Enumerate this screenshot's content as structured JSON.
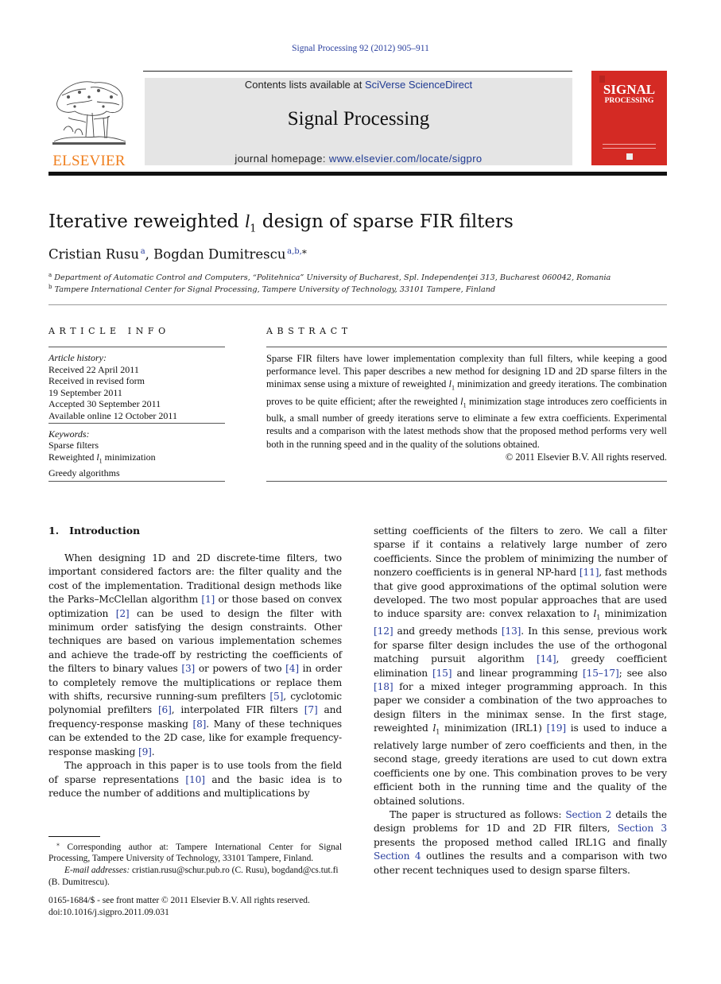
{
  "header": {
    "journal_ref": "Signal Processing 92 (2012) 905–911",
    "contents_prefix": "Contents lists available at ",
    "contents_link": "SciVerse ScienceDirect",
    "journal_title": "Signal Processing",
    "homepage_prefix": "journal homepage: ",
    "homepage_link": "www.elsevier.com/locate/sigpro",
    "publisher_logo_text": "ELSEVIER",
    "cover_title_line1": "SIGNAL",
    "cover_title_line2": "PROCESSING",
    "colors": {
      "elsevier_orange": "#f07f1e",
      "cover_red": "#d42a24",
      "link_blue": "#2a3f9e",
      "banner_gray": "#e5e5e5"
    }
  },
  "article": {
    "title_before": "Iterative reweighted ",
    "title_var": "l",
    "title_sub": "1",
    "title_after": " design of sparse FIR filters",
    "authors": [
      {
        "name": "Cristian Rusu",
        "marks": "a",
        "sep": ", "
      },
      {
        "name": "Bogdan Dumitrescu",
        "marks": "a,b,",
        "star": "⁎"
      }
    ],
    "affiliations": [
      {
        "mark": "a",
        "text": "Department of Automatic Control and Computers, “Politehnica” University of Bucharest, Spl. Independenţei 313, Bucharest 060042, Romania"
      },
      {
        "mark": "b",
        "text": "Tampere International Center for Signal Processing, Tampere University of Technology, 33101 Tampere, Finland"
      }
    ]
  },
  "article_info": {
    "heading": "ARTICLE INFO",
    "history_label": "Article history:",
    "history": [
      "Received 22 April 2011",
      "Received in revised form",
      "19 September 2011",
      "Accepted 30 September 2011",
      "Available online 12 October 2011"
    ],
    "keywords_label": "Keywords:",
    "keywords": [
      "Sparse filters",
      "Reweighted l1 minimization",
      "Greedy algorithms"
    ],
    "keyword2_before": "Reweighted ",
    "keyword2_var": "l",
    "keyword2_sub": "1",
    "keyword2_after": " minimization"
  },
  "abstract": {
    "heading": "ABSTRACT",
    "p1": "Sparse FIR filters have lower implementation complexity than full filters, while keeping a good performance level. This paper describes a new method for designing 1D and 2D sparse filters in the minimax sense using a mixture of reweighted ",
    "p2": " minimization and greedy iterations. The combination proves to be quite efficient; after the reweighted ",
    "p3": " minimization stage introduces zero coefficients in bulk, a small number of greedy iterations serve to eliminate a few extra coefficients. Experimental results and a comparison with the latest methods show that the proposed method performs very well both in the running speed and in the quality of the solutions obtained.",
    "l": "l",
    "one": "1",
    "copyright": "© 2011 Elsevier B.V. All rights reserved."
  },
  "intro": {
    "heading": "1.   Introduction",
    "left": {
      "s1": "When designing 1D and 2D discrete-time filters, two important considered factors are: the filter quality and the cost of the implementation. Traditional design methods like the Parks–McClellan algorithm ",
      "c1": "[1]",
      "s2": " or those based on convex optimization ",
      "c2": "[2]",
      "s3": " can be used to design the filter with minimum order satisfying the design constraints. Other techniques are based on various implementation schemes and achieve the trade-off by restricting the coefficients of the filters to binary values ",
      "c3": "[3]",
      "s4": " or powers of two ",
      "c4": "[4]",
      "s5": " in order to completely remove the multiplications or replace them with shifts, recursive running-sum prefilters ",
      "c5": "[5]",
      "s6": ", cyclotomic polynomial prefilters ",
      "c6": "[6]",
      "s7": ", interpolated FIR filters ",
      "c7": "[7]",
      "s8": " and frequency-response masking ",
      "c8": "[8]",
      "s9": ". Many of these techniques can be extended to the 2D case, like for example frequency-response masking ",
      "c9": "[9]",
      "s10": ".",
      "p2a": "The approach in this paper is to use tools from the field of sparse representations ",
      "c10": "[10]",
      "p2b": " and the basic idea is to reduce the number of additions and multiplications by"
    },
    "right": {
      "s1": "setting coefficients of the filters to zero. We call a filter sparse if it contains a relatively large number of zero coefficients. Since the problem of minimizing the number of nonzero coefficients is in general NP-hard ",
      "c11": "[11]",
      "s2": ", fast methods that give good approximations of the optimal solution were developed. The two most popular approaches that are used to induce sparsity are: convex relaxation to ",
      "s3": " minimization ",
      "c12": "[12]",
      "s4": " and greedy methods ",
      "c13": "[13]",
      "s5": ". In this sense, previous work for sparse filter design includes the use of the orthogonal matching pursuit algorithm ",
      "c14": "[14]",
      "s6": ", greedy coefficient elimination ",
      "c15": "[15]",
      "s7": " and linear programming ",
      "c1517": "[15–17]",
      "s8": "; see also ",
      "c18": "[18]",
      "s9": " for a mixed integer programming approach. In this paper we consider a combination of the two approaches to design filters in the minimax sense. In the first stage, reweighted ",
      "s10": " minimization (IRL1) ",
      "c19": "[19]",
      "s11": " is used to induce a relatively large number of zero coefficients and then, in the second stage, greedy iterations are used to cut down extra coefficients one by one. This combination proves to be very efficient both in the running time and the quality of the obtained solutions.",
      "p2a": "The paper is structured as follows: ",
      "sec2": "Section 2",
      "p2b": " details the design problems for 1D and 2D FIR filters, ",
      "sec3": "Section 3",
      "p2c": " presents the proposed method called IRL1G and finally ",
      "sec4": "Section 4",
      "p2d": " outlines the results and a comparison with two other recent techniques used to design sparse filters."
    }
  },
  "footnotes": {
    "star": "⁎",
    "corresponding": " Corresponding author at: Tampere International Center for Signal Processing, Tampere University of Technology, 33101 Tampere, Finland.",
    "email_label": "E-mail addresses:",
    "emails": " cristian.rusu@schur.pub.ro (C. Rusu), bogdand@cs.tut.fi (B. Dumitrescu).",
    "front_matter": "0165-1684/$ - see front matter © 2011 Elsevier B.V. All rights reserved.",
    "doi": "doi:10.1016/j.sigpro.2011.09.031"
  }
}
